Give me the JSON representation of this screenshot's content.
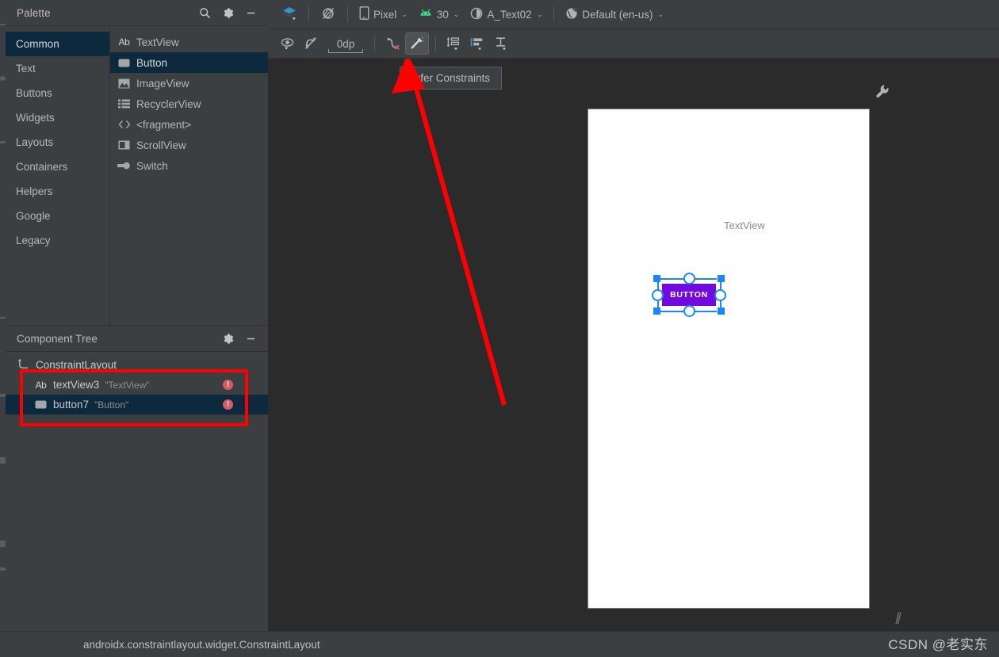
{
  "palette": {
    "title": "Palette",
    "icons": {
      "search": "search-icon",
      "gear": "gear-icon",
      "minimize": "minimize-icon"
    },
    "categories": [
      {
        "label": "Common",
        "selected": true
      },
      {
        "label": "Text",
        "selected": false
      },
      {
        "label": "Buttons",
        "selected": false
      },
      {
        "label": "Widgets",
        "selected": false
      },
      {
        "label": "Layouts",
        "selected": false
      },
      {
        "label": "Containers",
        "selected": false
      },
      {
        "label": "Helpers",
        "selected": false
      },
      {
        "label": "Google",
        "selected": false
      },
      {
        "label": "Legacy",
        "selected": false
      }
    ],
    "items": [
      {
        "label": "TextView",
        "icon": "textview-icon",
        "selected": false
      },
      {
        "label": "Button",
        "icon": "button-icon",
        "selected": true
      },
      {
        "label": "ImageView",
        "icon": "imageview-icon",
        "selected": false
      },
      {
        "label": "RecyclerView",
        "icon": "recyclerview-icon",
        "selected": false
      },
      {
        "label": "<fragment>",
        "icon": "fragment-icon",
        "selected": false
      },
      {
        "label": "ScrollView",
        "icon": "scrollview-icon",
        "selected": false
      },
      {
        "label": "Switch",
        "icon": "switch-icon",
        "selected": false
      }
    ]
  },
  "component_tree": {
    "title": "Component Tree",
    "icons": {
      "gear": "gear-icon",
      "minimize": "minimize-icon"
    },
    "rows": [
      {
        "id": "ConstraintLayout",
        "value": "",
        "icon": "constraintlayout-icon",
        "selected": false,
        "error": false
      },
      {
        "id": "textView3",
        "value": "\"TextView\"",
        "icon": "textview-icon",
        "selected": false,
        "error": true
      },
      {
        "id": "button7",
        "value": "\"Button\"",
        "icon": "button-icon",
        "selected": true,
        "error": true
      }
    ],
    "error_badge_glyph": "!"
  },
  "toolbar_top": {
    "design_mode": {
      "label": "",
      "icon": "layers-icon"
    },
    "orientation": {
      "label": "",
      "icon": "rotate-orientation-icon"
    },
    "device": {
      "label": "Pixel",
      "icon": "phone-icon",
      "caret": "⌄"
    },
    "api_level": {
      "label": "30",
      "icon": "android-icon",
      "caret": "⌄"
    },
    "theme": {
      "label": "A_Text02",
      "icon": "theme-contrast-icon",
      "caret": "⌄"
    },
    "locale": {
      "label": "Default (en-us)",
      "icon": "globe-icon",
      "caret": "⌄"
    }
  },
  "toolbar_second": {
    "view_options": {
      "name": "view-options-icon",
      "label": ""
    },
    "autoconnect": {
      "name": "autoconnect-off-icon",
      "label": ""
    },
    "default_margin": {
      "value": "0dp",
      "name": "default-margin-field"
    },
    "clear_constraints": {
      "name": "clear-constraints-icon",
      "label": ""
    },
    "infer_constraints": {
      "name": "infer-constraints-icon",
      "label": "",
      "active": true
    },
    "pack": {
      "name": "pack-icon",
      "label": ""
    },
    "align": {
      "name": "align-icon",
      "label": ""
    },
    "guidelines": {
      "name": "guidelines-icon",
      "label": ""
    }
  },
  "tooltip": {
    "text": "Infer Constraints"
  },
  "canvas": {
    "wrench": "wrench-icon",
    "preview": {
      "textview_label": "TextView",
      "button_label": "BUTTON",
      "button_color": "#7209df",
      "handle_color": "#1a86ff"
    }
  },
  "status_bar": {
    "text": "androidx.constraintlayout.widget.ConstraintLayout"
  },
  "watermark": {
    "text": "CSDN @老实东",
    "slashes": "//"
  },
  "colors": {
    "panel_bg": "#3c3f41",
    "canvas_bg": "#2b2b2b",
    "selection_bg": "#0d293e",
    "accent_blue": "#1a86ff",
    "annotation_red": "#ff0000",
    "error_red": "#db5860",
    "android_green": "#3ddc84"
  }
}
